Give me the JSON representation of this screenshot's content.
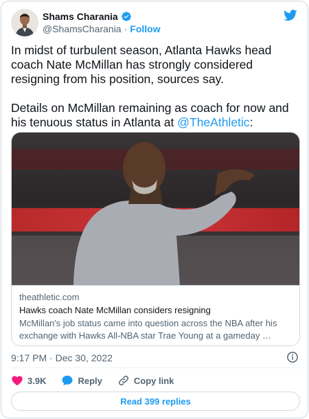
{
  "author": {
    "name": "Shams Charania",
    "handle": "@ShamsCharania",
    "separator": "·",
    "follow_label": "Follow"
  },
  "tweet": {
    "paragraph1": "In midst of turbulent season, Atlanta Hawks head coach Nate McMillan has strongly considered resigning from his position, sources say.",
    "paragraph2_prefix": "Details on McMillan remaining as coach for now and his tenuous status in Atlanta at ",
    "mention": "@TheAthletic",
    "paragraph2_suffix": ":"
  },
  "card": {
    "domain": "theathletic.com",
    "title": "Hawks coach Nate McMillan considers resigning",
    "description": "McMillan's job status came into question across the NBA after his exchange with Hawks All-NBA star Trae Young at a gameday …"
  },
  "meta": {
    "timestamp": "9:17 PM · Dec 30, 2022"
  },
  "actions": {
    "like_count": "3.9K",
    "reply_label": "Reply",
    "copy_link_label": "Copy link"
  },
  "read_replies_label": "Read 399 replies",
  "colors": {
    "brand_blue": "#1d9bf0",
    "like_red": "#f91880",
    "text_primary": "#0f1419",
    "text_secondary": "#536471",
    "border": "#cfd9de"
  },
  "icons": [
    "verified-badge-icon",
    "twitter-bird-icon",
    "info-icon",
    "heart-icon",
    "reply-bubble-icon",
    "link-icon"
  ]
}
